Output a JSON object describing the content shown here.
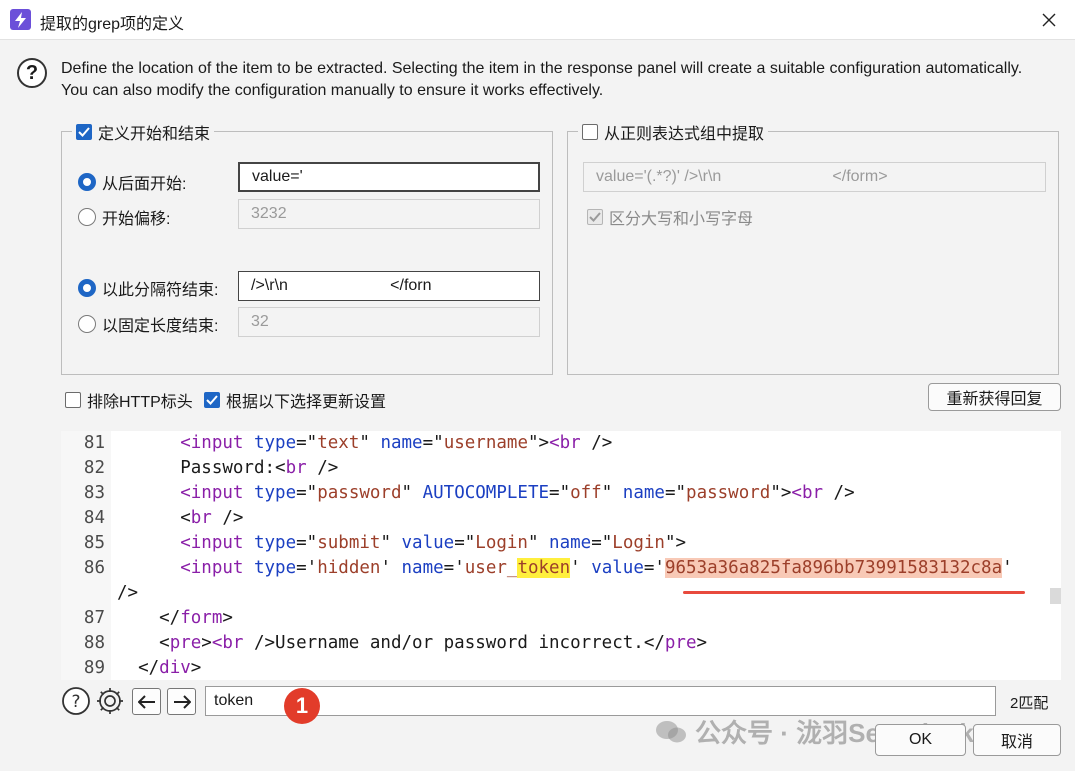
{
  "window": {
    "title": "提取的grep项的定义",
    "icon": "lightning-app-icon"
  },
  "description": "Define the location of the item to be extracted. Selecting the item in the response panel will create a suitable configuration automatically. You can also modify the configuration manually to ensure it works effectively.",
  "left_group": {
    "label": "定义开始和结束",
    "checked": true,
    "start_after": {
      "label": "从后面开始:",
      "value": "value='",
      "selected": true
    },
    "start_offset": {
      "label": "开始偏移:",
      "value": "3232",
      "selected": false
    },
    "end_delimiter": {
      "label": "以此分隔符结束:",
      "value": "/>\\r\\n                       </forn",
      "selected": true
    },
    "end_fixed": {
      "label": "以固定长度结束:",
      "value": "32",
      "selected": false
    }
  },
  "right_group": {
    "label": "从正则表达式组中提取",
    "checked": false,
    "regex_value": "value='(.*?)' />\\r\\n                         </form>",
    "case_sensitive_label": "区分大写和小写字母"
  },
  "options": {
    "exclude_http_headers": "排除HTTP标头",
    "update_config": "根据以下选择更新设置",
    "refetch_button": "重新获得回复"
  },
  "code": {
    "lines": [
      {
        "n": "81",
        "parts": [
          [
            "txt",
            "      "
          ],
          [
            "tag",
            "<input"
          ],
          [
            "txt",
            " "
          ],
          [
            "attr",
            "type"
          ],
          [
            "txt",
            "=\""
          ],
          [
            "str",
            "text"
          ],
          [
            "txt",
            "\" "
          ],
          [
            "attr",
            "name"
          ],
          [
            "txt",
            "=\""
          ],
          [
            "str",
            "username"
          ],
          [
            "txt",
            "\">"
          ],
          [
            "tag",
            "<br"
          ],
          [
            "txt",
            " />"
          ]
        ]
      },
      {
        "n": "82",
        "parts": [
          [
            "txt",
            "      Password:<"
          ],
          [
            "tag",
            "br"
          ],
          [
            "txt",
            " />"
          ]
        ]
      },
      {
        "n": "83",
        "parts": [
          [
            "txt",
            "      "
          ],
          [
            "tag",
            "<input"
          ],
          [
            "txt",
            " "
          ],
          [
            "attr",
            "type"
          ],
          [
            "txt",
            "=\""
          ],
          [
            "str",
            "password"
          ],
          [
            "txt",
            "\" "
          ],
          [
            "attr",
            "AUTOCOMPLETE"
          ],
          [
            "txt",
            "=\""
          ],
          [
            "str",
            "off"
          ],
          [
            "txt",
            "\" "
          ],
          [
            "attr",
            "name"
          ],
          [
            "txt",
            "=\""
          ],
          [
            "str",
            "password"
          ],
          [
            "txt",
            "\">"
          ],
          [
            "tag",
            "<br"
          ],
          [
            "txt",
            " />"
          ]
        ]
      },
      {
        "n": "84",
        "parts": [
          [
            "txt",
            "      <"
          ],
          [
            "tag",
            "br"
          ],
          [
            "txt",
            " />"
          ]
        ]
      },
      {
        "n": "85",
        "parts": [
          [
            "txt",
            "      "
          ],
          [
            "tag",
            "<input"
          ],
          [
            "txt",
            " "
          ],
          [
            "attr",
            "type"
          ],
          [
            "txt",
            "=\""
          ],
          [
            "str",
            "submit"
          ],
          [
            "txt",
            "\" "
          ],
          [
            "attr",
            "value"
          ],
          [
            "txt",
            "=\""
          ],
          [
            "str",
            "Login"
          ],
          [
            "txt",
            "\" "
          ],
          [
            "attr",
            "name"
          ],
          [
            "txt",
            "=\""
          ],
          [
            "str",
            "Login"
          ],
          [
            "txt",
            "\">"
          ]
        ]
      },
      {
        "n": "86",
        "parts": [
          [
            "txt",
            "      "
          ],
          [
            "tag",
            "<input"
          ],
          [
            "txt",
            " "
          ],
          [
            "attr",
            "type"
          ],
          [
            "txt",
            "='"
          ],
          [
            "str",
            "hidden"
          ],
          [
            "txt",
            "' "
          ],
          [
            "attr",
            "name"
          ],
          [
            "txt",
            "='"
          ],
          [
            "str",
            "user_"
          ],
          [
            "hltok",
            "token"
          ],
          [
            "txt",
            "' "
          ],
          [
            "attr",
            "value"
          ],
          [
            "txt",
            "='"
          ],
          [
            "hlval",
            "9653a36a825fa896bb73991583132c8a"
          ],
          [
            "txt",
            "'"
          ]
        ]
      },
      {
        "n": "",
        "parts": [
          [
            "txt",
            "/>"
          ]
        ]
      },
      {
        "n": "87",
        "parts": [
          [
            "txt",
            "    </"
          ],
          [
            "tag",
            "form"
          ],
          [
            "txt",
            ">"
          ]
        ]
      },
      {
        "n": "88",
        "parts": [
          [
            "txt",
            "    <"
          ],
          [
            "tag",
            "pre"
          ],
          [
            "txt",
            ">"
          ],
          [
            "tag",
            "<br"
          ],
          [
            "txt",
            " />Username and/or password incorrect.</"
          ],
          [
            "tag",
            "pre"
          ],
          [
            "txt",
            ">"
          ]
        ]
      },
      {
        "n": "89",
        "parts": [
          [
            "txt",
            "  </"
          ],
          [
            "tag",
            "div"
          ],
          [
            "txt",
            ">"
          ]
        ]
      }
    ]
  },
  "search": {
    "value": "token",
    "match_count": "2匹配",
    "badge": "1"
  },
  "buttons": {
    "ok": "OK",
    "cancel": "取消"
  },
  "watermark": "公众号 · 泷羽Sec-Blanks",
  "colors": {
    "accent": "#1e66c5",
    "token_highlight": "#ffef3d",
    "value_highlight": "#f8c9b6",
    "annotation_red": "#e23c2a"
  }
}
